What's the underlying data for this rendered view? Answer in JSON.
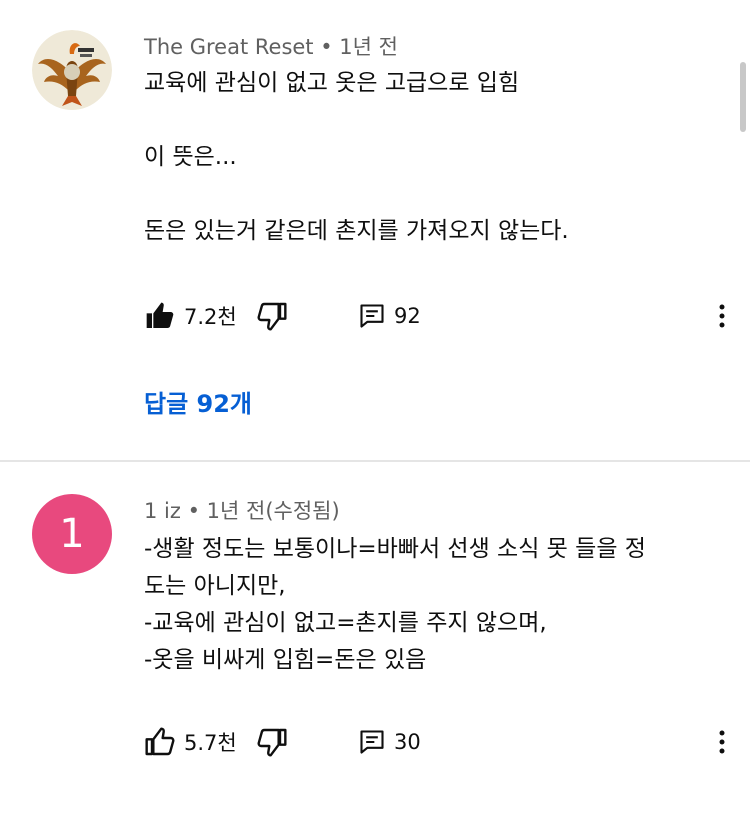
{
  "comments": [
    {
      "author": "The Great Reset",
      "time": "1년 전",
      "lines": [
        "교육에 관심이 없고 옷은 고급으로 입힘",
        "",
        "이 뜻은...",
        "",
        "돈은 있는거 같은데 촌지를 가져오지 않는다."
      ],
      "likes": "7.2천",
      "replies_count": "92",
      "replies_link": "답글 92개",
      "liked": true
    },
    {
      "author": "1 iz",
      "time": "1년 전(수정됨)",
      "avatar_letter": "1",
      "avatar_color": "#e8497e",
      "lines": [
        "-생활 정도는 보통이나=바빠서 선생 소식 못 들을 정",
        "도는 아니지만,",
        "-교육에 관심이 없고=촌지를 주지 않으며,",
        "-옷을 비싸게 입힘=돈은 있음"
      ],
      "likes": "5.7천",
      "replies_count": "30",
      "liked": false
    }
  ],
  "colors": {
    "link": "#065fd4",
    "meta": "#606060",
    "text": "#0f0f0f"
  },
  "icons": [
    "like-icon",
    "dislike-icon",
    "reply-icon",
    "more-vert-icon"
  ]
}
